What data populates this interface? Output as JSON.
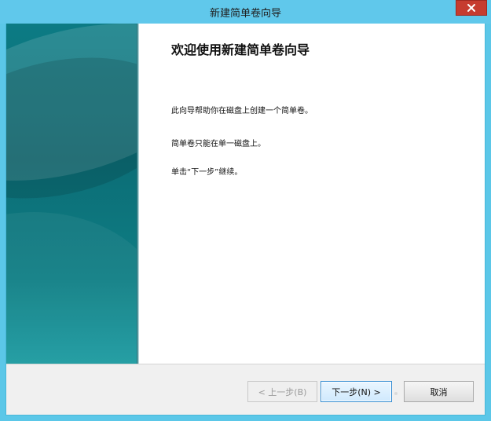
{
  "window": {
    "title": "新建简单卷向导",
    "accent_color": "#60c8eb",
    "close_color": "#c63c2f"
  },
  "wizard": {
    "heading": "欢迎使用新建简单卷向导",
    "paragraphs": [
      "此向导帮助你在磁盘上创建一个简单卷。",
      "简单卷只能在单一磁盘上。",
      "单击“下一步”继续。"
    ]
  },
  "buttons": {
    "back": "< 上一步(B)",
    "next": "下一步(N) >",
    "cancel": "取消"
  },
  "icons": {
    "close": "close-icon"
  }
}
